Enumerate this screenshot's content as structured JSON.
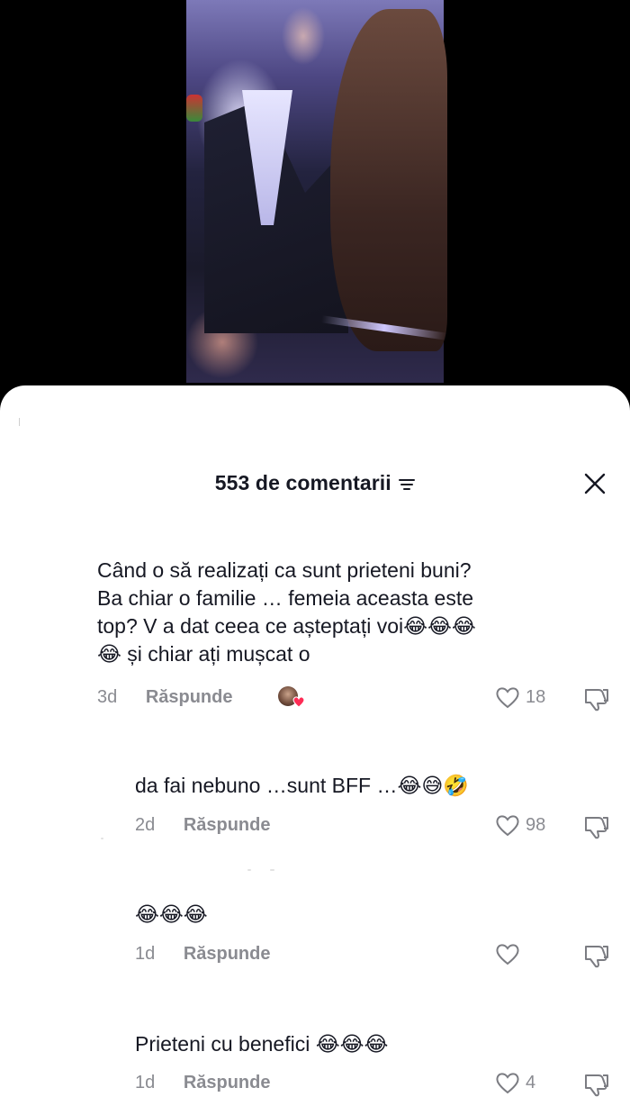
{
  "header": {
    "title": "553 de comentarii"
  },
  "comments": [
    {
      "text_lines": [
        "Când o să realizați ca sunt prieteni buni?",
        "Ba chiar o familie … femeia aceasta este",
        "top? V a dat ceea ce așteptați voi😂😂😂",
        "😂 și chiar ați mușcat o"
      ],
      "date": "3d",
      "reply_label": "Răspunde",
      "likes": "18",
      "creator_liked": true
    },
    {
      "text": "da fai nebuno …sunt BFF …😂😅🤣",
      "date": "2d",
      "reply_label": "Răspunde",
      "likes": "98"
    },
    {
      "text": "😂😂😂",
      "date": "1d",
      "reply_label": "Răspunde",
      "likes": ""
    },
    {
      "text": "Prieteni cu benefici 😂😂😂",
      "date": "1d",
      "reply_label": "Răspunde",
      "likes": "4"
    }
  ],
  "icons": {
    "filter": "filter-icon",
    "close": "close-icon",
    "like": "heart-outline-icon",
    "dislike": "thumbs-down-icon"
  }
}
